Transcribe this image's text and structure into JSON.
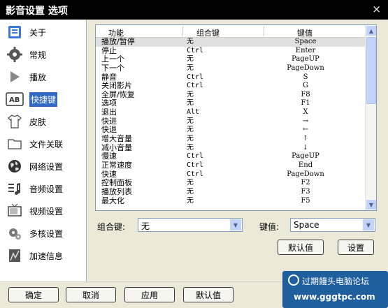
{
  "window": {
    "title": "影音设置 选项",
    "close_icon": "×"
  },
  "sidebar": {
    "items": [
      {
        "label": "关于",
        "icon": "about-icon"
      },
      {
        "label": "常规",
        "icon": "gear-icon"
      },
      {
        "label": "播放",
        "icon": "play-icon"
      },
      {
        "label": "快捷键",
        "icon": "keyboard-ab-icon",
        "active": true
      },
      {
        "label": "皮肤",
        "icon": "tshirt-icon"
      },
      {
        "label": "文件关联",
        "icon": "folder-icon"
      },
      {
        "label": "网络设置",
        "icon": "globe-icon"
      },
      {
        "label": "音频设置",
        "icon": "audio-icon"
      },
      {
        "label": "视频设置",
        "icon": "tv-icon"
      },
      {
        "label": "多核设置",
        "icon": "multicore-icon"
      },
      {
        "label": "加速信息",
        "icon": "accelerate-icon"
      }
    ]
  },
  "hotkeys": {
    "columns": [
      "功能",
      "组合键",
      "键值"
    ],
    "rows": [
      {
        "func": "播放/暂停",
        "combo": "无",
        "key": "Space",
        "selected": true
      },
      {
        "func": "停止",
        "combo": "Ctrl",
        "key": "Enter"
      },
      {
        "func": "上一个",
        "combo": "无",
        "key": "PageUP"
      },
      {
        "func": "下一个",
        "combo": "无",
        "key": "PageDown"
      },
      {
        "func": "静音",
        "combo": "Ctrl",
        "key": "S"
      },
      {
        "func": "关闭影片",
        "combo": "Ctrl",
        "key": "G"
      },
      {
        "func": "全屏/恢复",
        "combo": "无",
        "key": "F8"
      },
      {
        "func": "选项",
        "combo": "无",
        "key": "F1"
      },
      {
        "func": "退出",
        "combo": "Alt",
        "key": "X"
      },
      {
        "func": "快进",
        "combo": "无",
        "key": "→"
      },
      {
        "func": "快退",
        "combo": "无",
        "key": "←"
      },
      {
        "func": "增大音量",
        "combo": "无",
        "key": "↑"
      },
      {
        "func": "减小音量",
        "combo": "无",
        "key": "↓"
      },
      {
        "func": "慢速",
        "combo": "Ctrl",
        "key": "PageUP"
      },
      {
        "func": "正常速度",
        "combo": "Ctrl",
        "key": "End"
      },
      {
        "func": "快速",
        "combo": "Ctrl",
        "key": "PageDown"
      },
      {
        "func": "控制面板",
        "combo": "无",
        "key": "F2"
      },
      {
        "func": "播放列表",
        "combo": "无",
        "key": "F3"
      },
      {
        "func": "最大化",
        "combo": "无",
        "key": "F5"
      }
    ]
  },
  "editor": {
    "combo_label": "组合键:",
    "combo_value": "无",
    "key_label": "键值:",
    "key_value": "Space",
    "default_button": "默认值",
    "set_button": "设置"
  },
  "footer": {
    "ok": "确定",
    "cancel": "取消",
    "apply": "应用",
    "defaults": "默认值"
  },
  "watermark": {
    "line1": "过期饅头电脑论坛",
    "line2": "www.gggtpc.com"
  }
}
